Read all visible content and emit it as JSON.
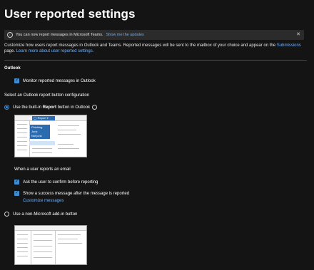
{
  "page": {
    "title": "User reported settings"
  },
  "banner": {
    "text": "You can now report messages in Microsoft Teams.",
    "link": "Show me the updates"
  },
  "description": {
    "text": "Customize how users report messages in Outlook and Teams. Reported messages will be sent to the mailbox of your choice and appear on the",
    "link1": "Submissions",
    "text2": "page.",
    "link2": "Learn more about user reported settings."
  },
  "outlook": {
    "heading": "Outlook",
    "monitor_label": "Monitor reported messages in Outlook",
    "config_heading": "Select an Outlook report button configuration",
    "builtin_prefix": "Use the built-in",
    "builtin_bold": "Report",
    "builtin_suffix": "button in Outlook",
    "illustration": {
      "button_label": "Report",
      "menu_items": [
        "Phishing",
        "Junk",
        "Not junk"
      ]
    },
    "when_heading": "When a user reports an email",
    "confirm_label": "Ask the user to confirm before reporting",
    "success_label": "Show a success message after the message is reported",
    "customize_link": "Customize messages",
    "nonms_label": "Use a non-Microsoft add-in button"
  },
  "colors": {
    "background": "#141414",
    "accent": "#3b8ed6",
    "link": "#6fb2ff"
  },
  "icons": {
    "banner": "info-icon",
    "banner_close": "close-icon",
    "checkbox": "checkmark-icon",
    "builtin_info": "info-icon"
  }
}
